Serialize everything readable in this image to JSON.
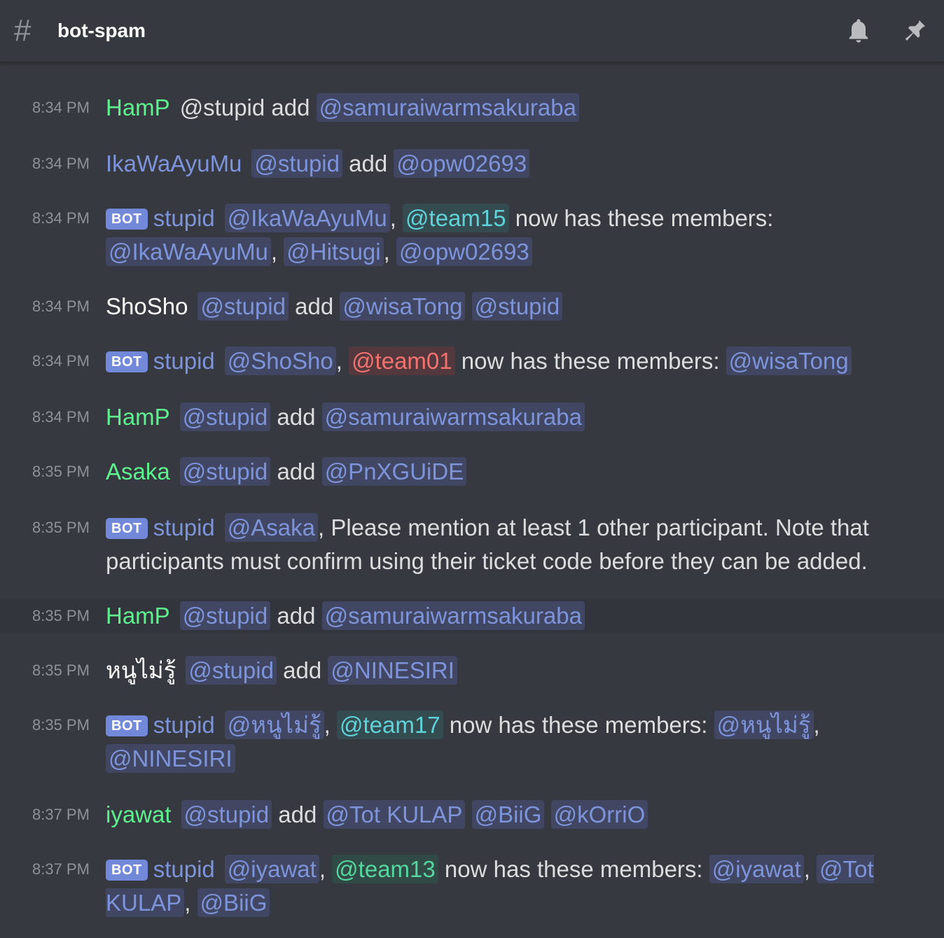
{
  "channel": {
    "name": "bot-spam",
    "hash_icon": "#"
  },
  "header_icons": [
    "bell-icon",
    "pin-icon"
  ],
  "colors": {
    "background": "#36393f",
    "hampp": "#5ef28f",
    "ikawa": "#7e94da",
    "bot": "#7289da",
    "mention_bg": "#414763",
    "mention_fg": "#7e94da",
    "team_teal": "#5fd3d9",
    "team_red": "#f1726e",
    "team_green": "#55d69f"
  },
  "bot_tag": "BOT",
  "messages": [
    {
      "time": "8:34 PM",
      "author": "HamP",
      "parts": [
        {
          "t": "text",
          "v": "@stupid add "
        },
        {
          "t": "mention",
          "v": "@samuraiwarmsakuraba"
        }
      ]
    },
    {
      "time": "8:34 PM",
      "author": "IkaWaAyuMu",
      "parts": [
        {
          "t": "mention",
          "v": "@stupid"
        },
        {
          "t": "text",
          "v": " add "
        },
        {
          "t": "mention",
          "v": "@opw02693"
        }
      ]
    },
    {
      "time": "8:34 PM",
      "author": "stupid",
      "bot": true,
      "parts": [
        {
          "t": "mention",
          "v": "@IkaWaAyuMu"
        },
        {
          "t": "text",
          "v": ", "
        },
        {
          "t": "team-teal",
          "v": "@team15"
        },
        {
          "t": "text",
          "v": " now has these members: "
        },
        {
          "t": "mention",
          "v": "@IkaWaAyuMu"
        },
        {
          "t": "text",
          "v": ", "
        },
        {
          "t": "mention",
          "v": "@Hitsugi"
        },
        {
          "t": "text",
          "v": ", "
        },
        {
          "t": "mention",
          "v": "@opw02693"
        }
      ]
    },
    {
      "time": "8:34 PM",
      "author": "ShoSho",
      "parts": [
        {
          "t": "mention",
          "v": "@stupid"
        },
        {
          "t": "text",
          "v": " add "
        },
        {
          "t": "mention",
          "v": "@wisaTong"
        },
        {
          "t": "text",
          "v": " "
        },
        {
          "t": "mention",
          "v": "@stupid"
        }
      ]
    },
    {
      "time": "8:34 PM",
      "author": "stupid",
      "bot": true,
      "parts": [
        {
          "t": "mention",
          "v": "@ShoSho"
        },
        {
          "t": "text",
          "v": ", "
        },
        {
          "t": "team-red",
          "v": "@team01"
        },
        {
          "t": "text",
          "v": " now has these members: "
        },
        {
          "t": "mention",
          "v": "@wisaTong"
        }
      ]
    },
    {
      "time": "8:34 PM",
      "author": "HamP",
      "parts": [
        {
          "t": "mention",
          "v": "@stupid"
        },
        {
          "t": "text",
          "v": " add "
        },
        {
          "t": "mention",
          "v": "@samuraiwarmsakuraba"
        }
      ]
    },
    {
      "time": "8:35 PM",
      "author": "Asaka",
      "parts": [
        {
          "t": "mention",
          "v": "@stupid"
        },
        {
          "t": "text",
          "v": " add "
        },
        {
          "t": "mention",
          "v": "@PnXGUiDE"
        }
      ]
    },
    {
      "time": "8:35 PM",
      "author": "stupid",
      "bot": true,
      "parts": [
        {
          "t": "mention",
          "v": "@Asaka"
        },
        {
          "t": "text",
          "v": ", Please mention at least 1 other participant. Note that participants must confirm using their ticket code before they can be added."
        }
      ]
    },
    {
      "time": "8:35 PM",
      "author": "HamP",
      "highlight": true,
      "parts": [
        {
          "t": "mention",
          "v": "@stupid"
        },
        {
          "t": "text",
          "v": " add "
        },
        {
          "t": "mention",
          "v": "@samuraiwarmsakuraba"
        }
      ]
    },
    {
      "time": "8:35 PM",
      "author": "หนูไม่รู้",
      "parts": [
        {
          "t": "mention",
          "v": "@stupid"
        },
        {
          "t": "text",
          "v": " add "
        },
        {
          "t": "mention",
          "v": "@NINESIRI"
        }
      ]
    },
    {
      "time": "8:35 PM",
      "author": "stupid",
      "bot": true,
      "parts": [
        {
          "t": "mention",
          "v": "@หนูไม่รู้"
        },
        {
          "t": "text",
          "v": ", "
        },
        {
          "t": "team-teal",
          "v": "@team17"
        },
        {
          "t": "text",
          "v": " now has these members: "
        },
        {
          "t": "mention",
          "v": "@หนูไม่รู้"
        },
        {
          "t": "text",
          "v": ", "
        },
        {
          "t": "mention",
          "v": "@NINESIRI"
        }
      ]
    },
    {
      "time": "8:37 PM",
      "author": "iyawat",
      "parts": [
        {
          "t": "mention",
          "v": "@stupid"
        },
        {
          "t": "text",
          "v": " add "
        },
        {
          "t": "mention",
          "v": "@Tot KULAP"
        },
        {
          "t": "text",
          "v": " "
        },
        {
          "t": "mention",
          "v": "@BiiG"
        },
        {
          "t": "text",
          "v": " "
        },
        {
          "t": "mention",
          "v": "@kOrriO"
        }
      ]
    },
    {
      "time": "8:37 PM",
      "author": "stupid",
      "bot": true,
      "parts": [
        {
          "t": "mention",
          "v": "@iyawat"
        },
        {
          "t": "text",
          "v": ", "
        },
        {
          "t": "team-green",
          "v": "@team13"
        },
        {
          "t": "text",
          "v": " now has these members: "
        },
        {
          "t": "mention",
          "v": "@iyawat"
        },
        {
          "t": "text",
          "v": ", "
        },
        {
          "t": "mention",
          "v": "@Tot KULAP"
        },
        {
          "t": "text",
          "v": ", "
        },
        {
          "t": "mention",
          "v": "@BiiG"
        }
      ]
    }
  ]
}
